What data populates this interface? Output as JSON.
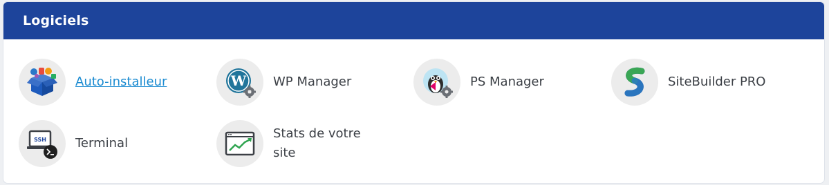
{
  "header": {
    "title": "Logiciels"
  },
  "apps": [
    {
      "label": "Auto-installeur",
      "icon": "box-icon"
    },
    {
      "label": "WP Manager",
      "icon": "wordpress-icon"
    },
    {
      "label": "PS Manager",
      "icon": "prestashop-icon"
    },
    {
      "label": "SiteBuilder PRO",
      "icon": "sitebuilder-icon"
    },
    {
      "label": "Terminal",
      "icon": "ssh-terminal-icon"
    },
    {
      "label": "Stats de votre site",
      "icon": "stats-chart-icon"
    }
  ],
  "terminal_badge": "SSH",
  "colors": {
    "header": "#1d449b",
    "link": "#1b8bd1",
    "text": "#3b3f45",
    "icon_bg": "#ececec"
  }
}
